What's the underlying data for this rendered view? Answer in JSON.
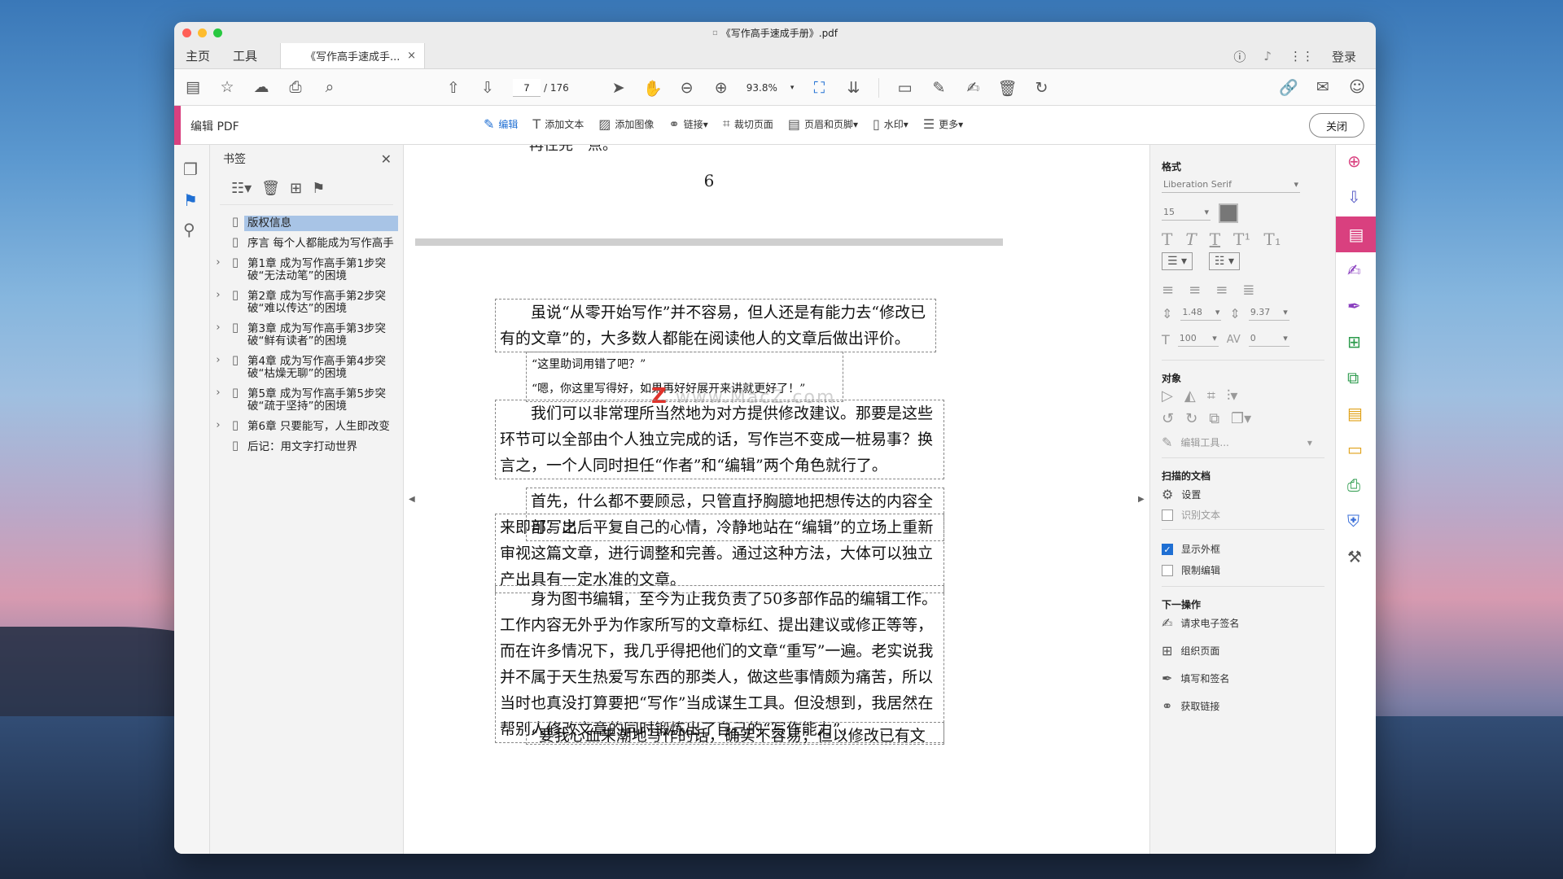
{
  "window": {
    "title": "《写作高手速成手册》.pdf"
  },
  "tabs": {
    "home": "主页",
    "tools": "工具",
    "document": "《写作高手速成手...",
    "close": "×",
    "login": "登录"
  },
  "toolbar": {
    "page_current": "7",
    "page_total": "/ 176",
    "zoom": "93.8%"
  },
  "editbar": {
    "label": "编辑 PDF",
    "tools": [
      "编辑",
      "添加文本",
      "添加图像",
      "链接▾",
      "裁切页面",
      "页眉和页脚▾",
      "水印▾",
      "更多▾"
    ],
    "close": "关闭"
  },
  "bookmarks": {
    "title": "书签",
    "items": [
      {
        "label": "版权信息",
        "expandable": false,
        "selected": true
      },
      {
        "label": "序言 每个人都能成为写作高手",
        "expandable": false,
        "selected": false
      },
      {
        "label": "第1章 成为写作高手第1步突破“无法动笔”的困境",
        "expandable": true,
        "selected": false
      },
      {
        "label": "第2章 成为写作高手第2步突破“难以传达”的困境",
        "expandable": true,
        "selected": false
      },
      {
        "label": "第3章 成为写作高手第3步突破“鲜有读者”的困境",
        "expandable": true,
        "selected": false
      },
      {
        "label": "第4章 成为写作高手第4步突破“枯燥无聊”的困境",
        "expandable": true,
        "selected": false
      },
      {
        "label": "第5章 成为写作高手第5步突破“疏于坚持”的困境",
        "expandable": true,
        "selected": false
      },
      {
        "label": "第6章 只要能写，人生即改变",
        "expandable": true,
        "selected": false
      },
      {
        "label": "后记：用文字打动世界",
        "expandable": false,
        "selected": false
      }
    ]
  },
  "document": {
    "prev_page_fragment": "再往完一点。",
    "page_number": "6",
    "watermark": "www.MacZ.com",
    "para1": "虽说“从零开始写作”并不容易，但人还是有能力去“修改已有的文章”的，大多数人都能在阅读他人的文章后做出评价。",
    "quote1": "“这里助词用错了吧？”",
    "quote2": "“嗯，你这里写得好，如果再好好展开来讲就更好了！”",
    "para2": "我们可以非常理所当然地为对方提供修改建议。那要是这些环节可以全部由个人独立完成的话，写作岂不变成一桩易事？换言之，一个人同时担任“作者”和“编辑”两个角色就行了。",
    "para3a": "首先，什么都不要顾忌，只管直抒胸臆地把想传达的内容全部写出",
    "para3b": "来即可。之后平复自己的心情，冷静地站在“编辑”的立场上重新审视这篇文章，进行调整和完善。通过这种方法，大体可以独立产出具有一定水准的文章。",
    "para4": "身为图书编辑，至今为止我负责了50多部作品的编辑工作。工作内容无外乎为作家所写的文章标红、提出建议或修正等等，而在许多情况下，我几乎得把他们的文章“重写”一遍。老实说我并不属于天生热爱写东西的那类人，做这些事情颇为痛苦，所以当时也真没打算要把“写作”当成谋生工具。但没想到，我居然在帮别人修改文章的同时锻炼出了自己的“写作能力”。",
    "para5": "“要我心血来潮地写作的话，确实不容易；但以修改已有文章的形"
  },
  "format": {
    "title": "格式",
    "font": "Liberation Serif",
    "size": "15",
    "line_spacing": "1.48",
    "para_spacing": "9.37",
    "scale": "100",
    "tracking": "0",
    "objects_title": "对象",
    "edit_tools": "编辑工具...",
    "scanned_title": "扫描的文档",
    "settings": "设置",
    "ocr": "识别文本",
    "show_box": "显示外框",
    "restrict": "限制编辑",
    "next_title": "下一操作",
    "next": [
      "请求电子签名",
      "组织页面",
      "填写和签名",
      "获取链接"
    ]
  },
  "colors": {
    "accent": "#d9407f",
    "blue": "#1f6fd3",
    "selected": "#a8c4e6"
  }
}
